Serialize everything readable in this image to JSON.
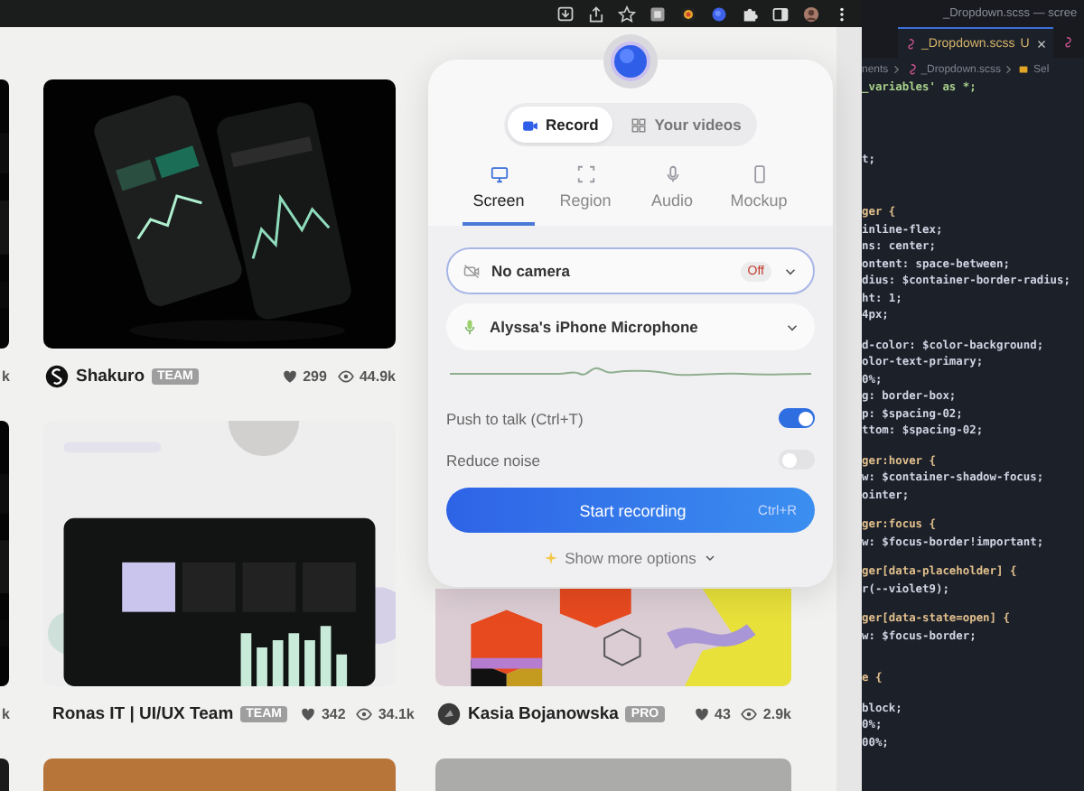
{
  "shot_grid": {
    "columns": [
      {
        "kind": "partial",
        "shots": [
          {
            "views": "k"
          },
          {
            "views": "k"
          }
        ]
      },
      {
        "kind": "full",
        "shots": [
          {
            "author": "Shakuro",
            "badge": "TEAM",
            "likes": "299",
            "views": "44.9k"
          },
          {
            "author": "Ronas IT | UI/UX Team",
            "badge": "TEAM",
            "likes": "342",
            "views": "34.1k"
          }
        ]
      },
      {
        "kind": "covered",
        "shots": [
          {
            "author": "Kasia Bojanowska",
            "badge": "PRO",
            "likes": "43",
            "views": "2.9k"
          }
        ]
      }
    ]
  },
  "recorder": {
    "mode_switch": [
      {
        "label": "Record",
        "selected": true
      },
      {
        "label": "Your videos",
        "selected": false
      }
    ],
    "capture_tabs": [
      {
        "label": "Screen",
        "selected": true
      },
      {
        "label": "Region",
        "selected": false
      },
      {
        "label": "Audio",
        "selected": false
      },
      {
        "label": "Mockup",
        "selected": false
      }
    ],
    "camera_select": {
      "value": "No camera",
      "badge": "Off"
    },
    "microphone_select": {
      "value": "Alyssa's iPhone Microphone"
    },
    "toggles": [
      {
        "label": "Push to talk (Ctrl+T)",
        "on": true
      },
      {
        "label": "Reduce noise",
        "on": false
      }
    ],
    "start_button": {
      "label": "Start recording",
      "shortcut": "Ctrl+R"
    },
    "more_options": "Show more options"
  },
  "editor": {
    "title": "_Dropdown.scss — scree",
    "tabs": [
      {
        "label": "_Dropdown.scss",
        "status": "U",
        "selected": true
      }
    ],
    "breadcrumb": [
      "nents",
      "_Dropdown.scss",
      "Sel"
    ],
    "code_blocks": [
      {
        "lines": [
          {
            "kind": "import",
            "text": "_variables' as *;"
          }
        ]
      },
      {
        "lines": [
          {
            "kind": "declaration",
            "text": "t;"
          }
        ]
      },
      {
        "lines": [
          {
            "kind": "selector",
            "text": "ger {"
          },
          {
            "kind": "declaration",
            "text": "inline-flex;"
          },
          {
            "kind": "declaration",
            "text": "ns: center;"
          },
          {
            "kind": "declaration",
            "text": "ontent: space-between;"
          },
          {
            "kind": "declaration",
            "text": "dius: $container-border-radius;"
          },
          {
            "kind": "declaration",
            "text": "ht: 1;"
          },
          {
            "kind": "declaration",
            "text": "4px;"
          }
        ]
      },
      {
        "lines": [
          {
            "kind": "declaration",
            "text": "d-color: $color-background;"
          },
          {
            "kind": "declaration",
            "text": "olor-text-primary;"
          },
          {
            "kind": "declaration",
            "text": "0%;"
          },
          {
            "kind": "declaration",
            "text": "g: border-box;"
          },
          {
            "kind": "declaration",
            "text": "p: $spacing-02;"
          },
          {
            "kind": "declaration",
            "text": "ttom: $spacing-02;"
          }
        ]
      },
      {
        "lines": [
          {
            "kind": "selector",
            "text": "ger:hover {"
          },
          {
            "kind": "declaration",
            "text": "w: $container-shadow-focus;"
          },
          {
            "kind": "declaration",
            "text": "ointer;"
          }
        ]
      },
      {
        "lines": [
          {
            "kind": "selector",
            "text": "ger:focus {"
          },
          {
            "kind": "declaration",
            "text": "w: $focus-border!important;"
          }
        ]
      },
      {
        "lines": [
          {
            "kind": "selector",
            "text": "ger[data-placeholder] {"
          },
          {
            "kind": "declaration",
            "text": "r(--violet9);"
          }
        ]
      },
      {
        "lines": [
          {
            "kind": "selector",
            "text": "ger[data-state=open] {"
          },
          {
            "kind": "declaration",
            "text": "w: $focus-border;"
          }
        ]
      },
      {
        "lines": [
          {
            "kind": "selector",
            "text": "e {"
          }
        ]
      },
      {
        "lines": [
          {
            "kind": "declaration",
            "text": "block;"
          },
          {
            "kind": "declaration",
            "text": "0%;"
          },
          {
            "kind": "declaration",
            "text": "00%;"
          }
        ]
      }
    ]
  }
}
